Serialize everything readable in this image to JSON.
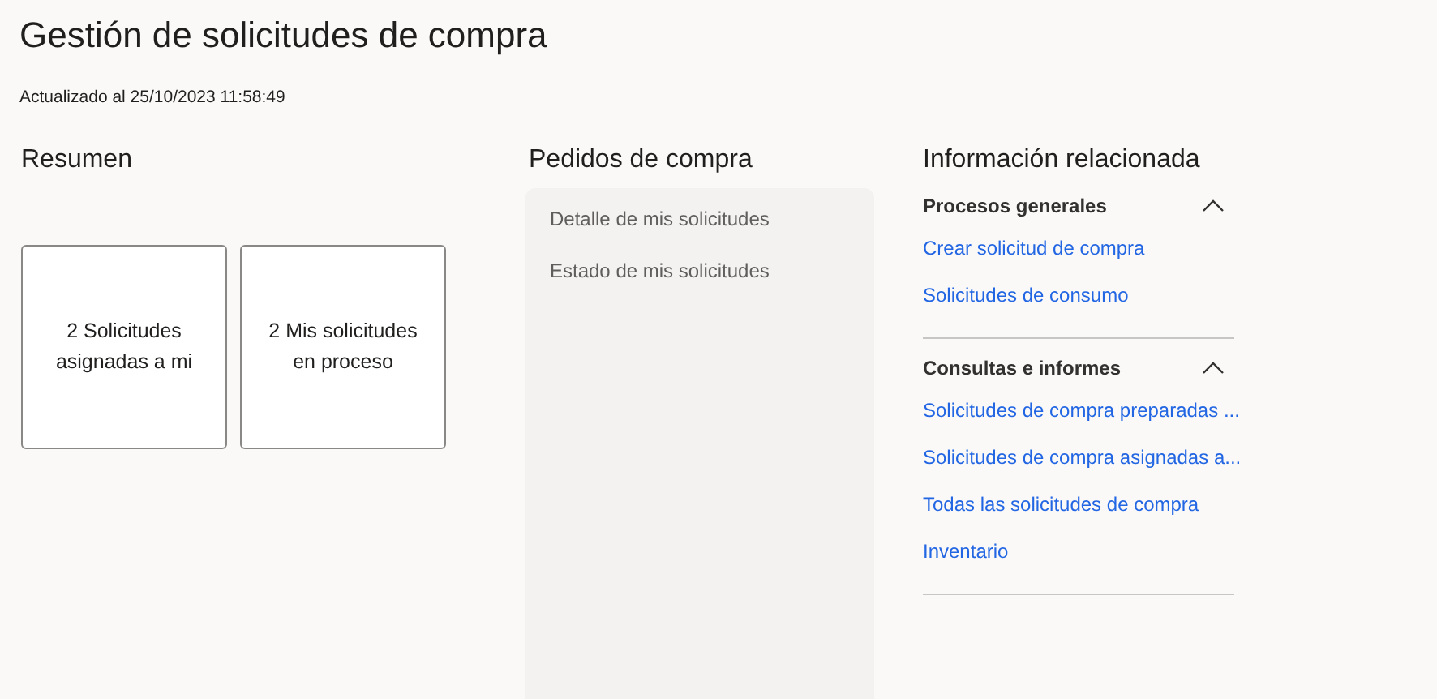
{
  "title": "Gestión de solicitudes de compra",
  "updated": "Actualizado al 25/10/2023 11:58:49",
  "summary": {
    "heading": "Resumen",
    "tiles": [
      "2 Solicitudes asignadas a mi",
      "2 Mis solicitudes en proceso"
    ]
  },
  "orders": {
    "heading": "Pedidos de compra",
    "items": [
      "Detalle de mis solicitudes",
      "Estado de mis solicitudes"
    ]
  },
  "related": {
    "heading": "Información relacionada",
    "groups": [
      {
        "title": "Procesos generales",
        "expanded": true,
        "links": [
          "Crear solicitud de compra",
          "Solicitudes de consumo"
        ]
      },
      {
        "title": "Consultas e informes",
        "expanded": true,
        "links": [
          "Solicitudes de compra preparadas ...",
          "Solicitudes de compra asignadas a...",
          "Todas las solicitudes de compra",
          "Inventario"
        ]
      }
    ]
  }
}
